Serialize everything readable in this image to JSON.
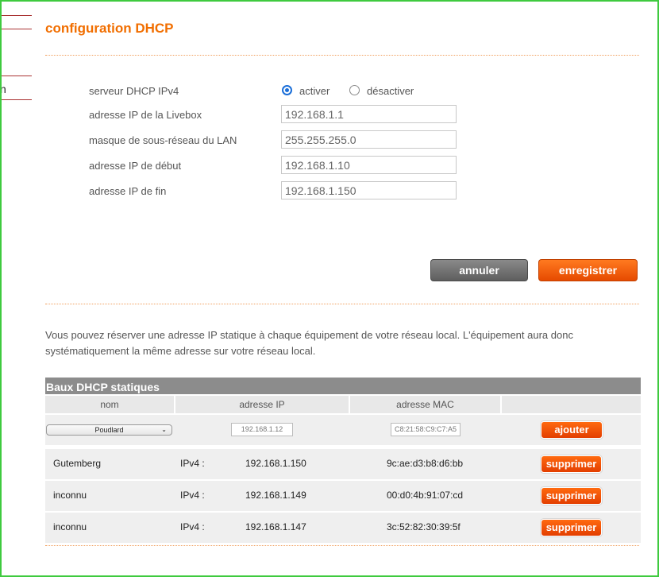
{
  "page": {
    "title": "configuration DHCP",
    "side_letter": "n"
  },
  "dhcp": {
    "server_label": "serveur DHCP IPv4",
    "activate_label": "activer",
    "deactivate_label": "désactiver",
    "fields": [
      {
        "label": "adresse IP de la Livebox",
        "value": "192.168.1.1"
      },
      {
        "label": "masque de sous-réseau du LAN",
        "value": "255.255.255.0"
      },
      {
        "label": "adresse IP de début",
        "value": "192.168.1.10"
      },
      {
        "label": "adresse IP de fin",
        "value": "192.168.1.150"
      }
    ],
    "cancel_label": "annuler",
    "save_label": "enregistrer"
  },
  "reservation": {
    "paragraph": "Vous pouvez réserver une adresse IP statique à chaque équipement de votre réseau local. L'équipement aura donc systématiquement la même adresse sur votre réseau local."
  },
  "table": {
    "title": "Baux DHCP statiques",
    "headers": [
      "nom",
      "adresse IP",
      "adresse MAC",
      ""
    ],
    "new_entry": {
      "device_selected": "Poudlard",
      "ip_value": "192.168.1.12",
      "mac_value": "C8:21:58:C9:C7:A5",
      "add_label": "ajouter"
    },
    "rows": [
      {
        "name": "Gutemberg",
        "ip_type": "IPv4 :",
        "ip": "192.168.1.150",
        "mac": "9c:ae:d3:b8:d6:bb",
        "action": "supprimer"
      },
      {
        "name": "inconnu",
        "ip_type": "IPv4 :",
        "ip": "192.168.1.149",
        "mac": "00:d0:4b:91:07:cd",
        "action": "supprimer"
      },
      {
        "name": "inconnu",
        "ip_type": "IPv4 :",
        "ip": "192.168.1.147",
        "mac": "3c:52:82:30:39:5f",
        "action": "supprimer"
      }
    ]
  },
  "colors": {
    "accent": "#f16e00",
    "frame": "#3fca3f",
    "table_header": "#8c8c8c"
  }
}
